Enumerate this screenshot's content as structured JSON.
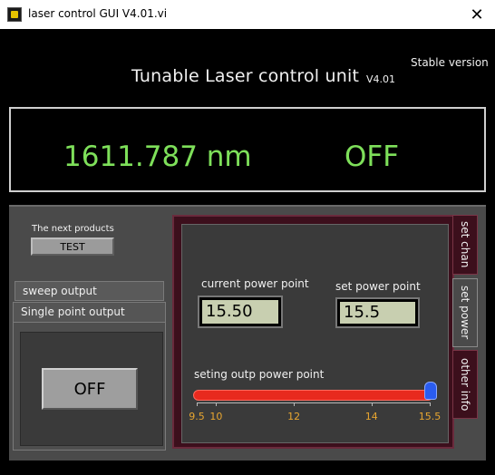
{
  "window": {
    "title": "laser control GUI V4.01.vi",
    "close_label": "✕"
  },
  "header": {
    "stable_version": "Stable version",
    "title": "Tunable Laser control unit",
    "version": "V4.01"
  },
  "display": {
    "wavelength": "1611.787 nm",
    "state": "OFF"
  },
  "next_products": {
    "label": "The next products",
    "button": "TEST"
  },
  "left_tabs": {
    "sweep": "sweep output",
    "single": "Single point output",
    "output_button": "OFF"
  },
  "right_tabs": {
    "tabs": [
      "set chan",
      "set power",
      "other info"
    ],
    "active": "set power"
  },
  "power": {
    "current_label": "current power point",
    "current_value": "15.50",
    "set_label": "set power point",
    "set_value": "15.5",
    "slider_label": "seting outp power point",
    "slider": {
      "min": 9.5,
      "max": 15.5,
      "value": 15.5
    },
    "scale_labels": [
      "9.5",
      "10",
      "12",
      "14",
      "15.5"
    ],
    "scale_values": [
      9.5,
      10,
      12,
      14,
      15.5
    ]
  },
  "colors": {
    "readout_green": "#7ee05a",
    "tab_maroon": "#3c0f1c",
    "slider_red": "#e82a1e",
    "slider_thumb_blue": "#2a5cf0",
    "scale_orange": "#e8a630"
  }
}
